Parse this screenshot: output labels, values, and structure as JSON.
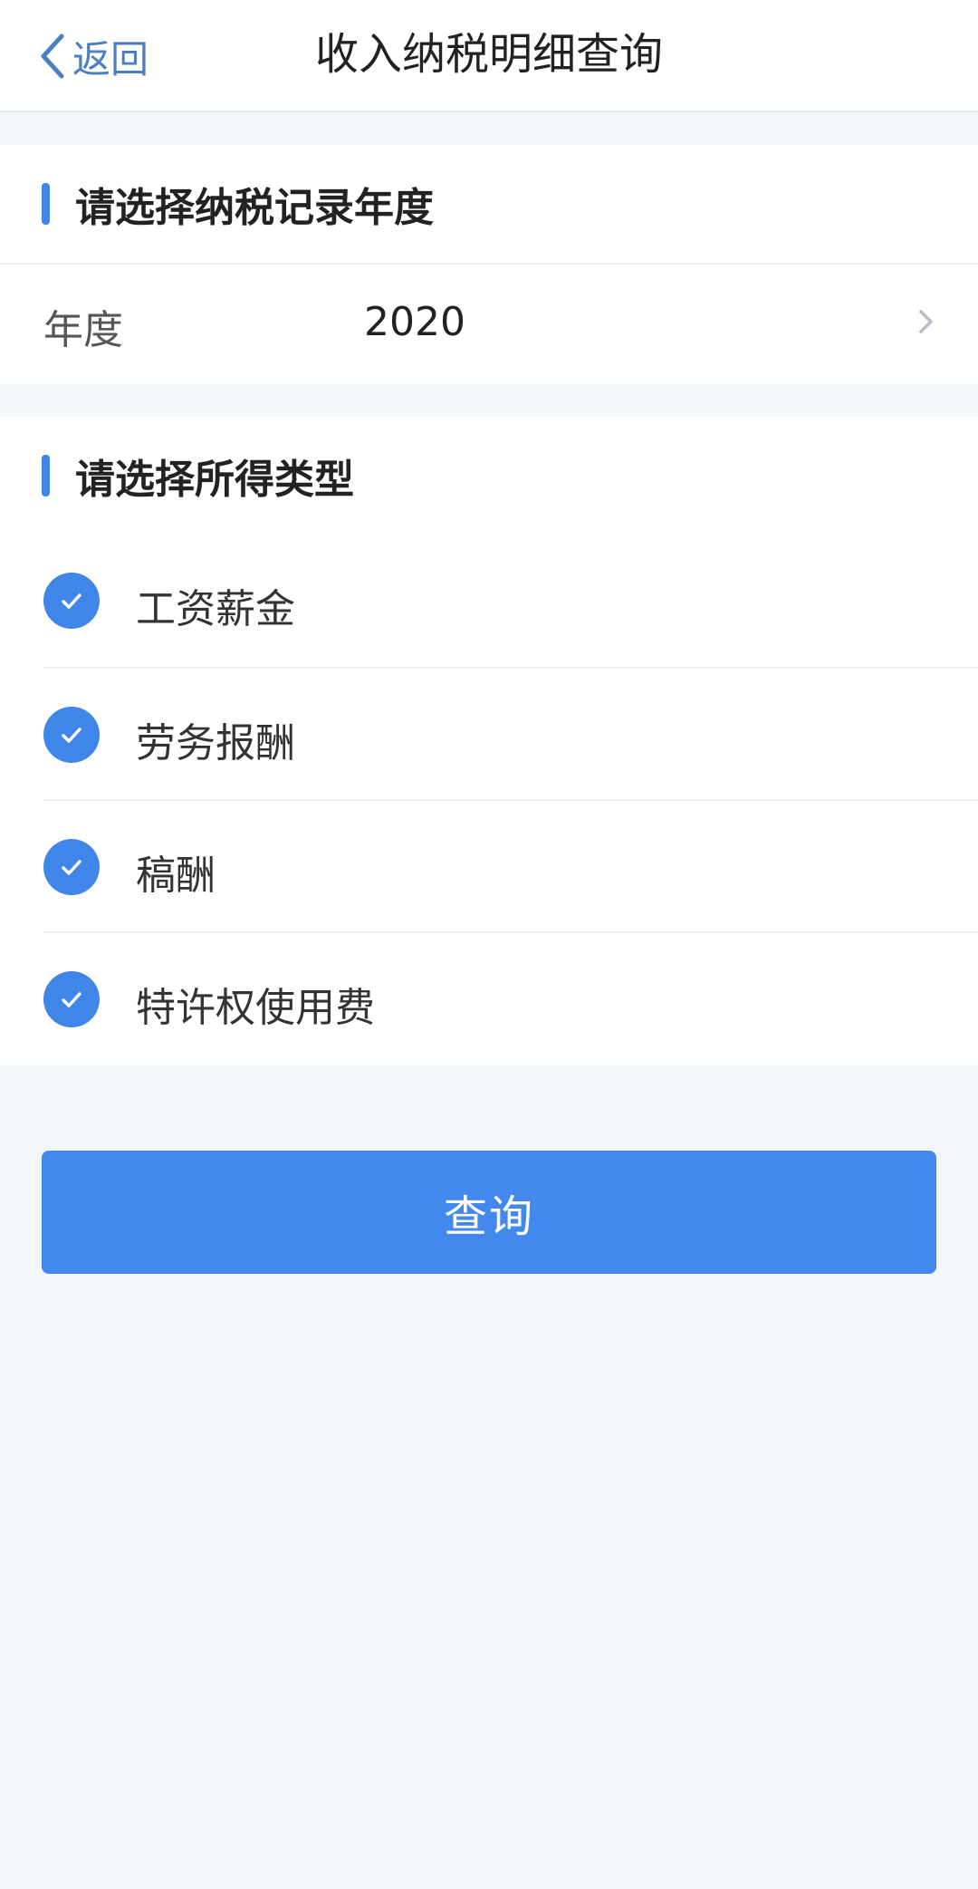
{
  "nav": {
    "back_label": "返回",
    "title": "收入纳税明细查询"
  },
  "year_section": {
    "title": "请选择纳税记录年度",
    "row_label": "年度",
    "row_value": "2020"
  },
  "type_section": {
    "title": "请选择所得类型",
    "options": [
      {
        "label": "工资薪金",
        "checked": true
      },
      {
        "label": "劳务报酬",
        "checked": true
      },
      {
        "label": "稿酬",
        "checked": true
      },
      {
        "label": "特许权使用费",
        "checked": true
      }
    ]
  },
  "query_button": {
    "label": "查询"
  },
  "colors": {
    "accent": "#4388ec",
    "back_link": "#4a7fc1",
    "page_bg": "#f3f6fa"
  }
}
